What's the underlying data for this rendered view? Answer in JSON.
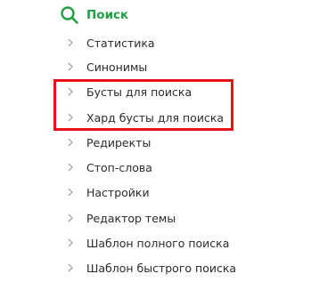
{
  "section": {
    "title": "Поиск",
    "icon": "search-icon",
    "accent_color": "#22a045"
  },
  "menu": {
    "items": [
      {
        "label": "Статистика"
      },
      {
        "label": "Синонимы"
      },
      {
        "label": "Бусты для поиска"
      },
      {
        "label": "Хард бусты для поиска"
      },
      {
        "label": "Редиректы"
      },
      {
        "label": "Стоп-слова"
      },
      {
        "label": "Настройки"
      },
      {
        "label": "Редактор темы"
      },
      {
        "label": "Шаблон полного поиска"
      },
      {
        "label": "Шаблон быстрого поиска"
      }
    ]
  },
  "highlight": {
    "color": "#e8131a"
  }
}
